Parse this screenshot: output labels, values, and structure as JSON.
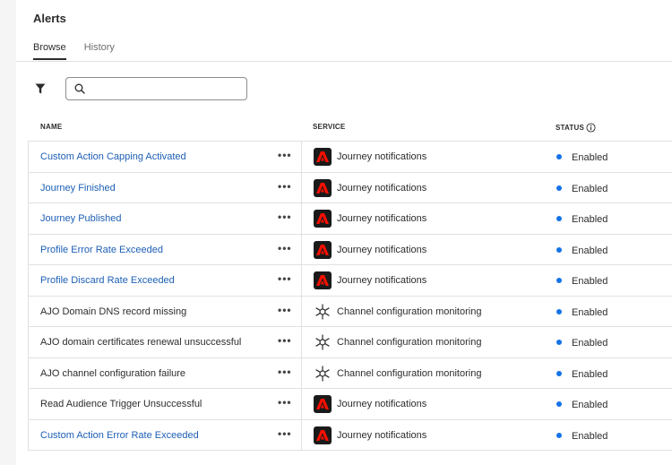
{
  "page": {
    "title": "Alerts",
    "tabs": [
      {
        "label": "Browse",
        "active": true
      },
      {
        "label": "History",
        "active": false
      }
    ]
  },
  "toolbar": {
    "filter_icon": "filter-icon",
    "search": {
      "placeholder": "",
      "value": "",
      "icon": "search-icon"
    }
  },
  "table": {
    "columns": {
      "name": "NAME",
      "service": "SERVICE",
      "status": "STATUS"
    },
    "rows": [
      {
        "name": "Custom Action Capping Activated",
        "link": true,
        "service": "Journey notifications",
        "service_icon": "adobe-icon",
        "status": "Enabled"
      },
      {
        "name": "Journey Finished",
        "link": true,
        "service": "Journey notifications",
        "service_icon": "adobe-icon",
        "status": "Enabled"
      },
      {
        "name": "Journey Published",
        "link": true,
        "service": "Journey notifications",
        "service_icon": "adobe-icon",
        "status": "Enabled"
      },
      {
        "name": "Profile Error Rate Exceeded",
        "link": true,
        "service": "Journey notifications",
        "service_icon": "adobe-icon",
        "status": "Enabled"
      },
      {
        "name": "Profile Discard Rate Exceeded",
        "link": true,
        "service": "Journey notifications",
        "service_icon": "adobe-icon",
        "status": "Enabled"
      },
      {
        "name": "AJO Domain DNS record missing",
        "link": false,
        "service": "Channel configuration monitoring",
        "service_icon": "network-hub-icon",
        "status": "Enabled"
      },
      {
        "name": "AJO domain certificates renewal unsuccessful",
        "link": false,
        "service": "Channel configuration monitoring",
        "service_icon": "network-hub-icon",
        "status": "Enabled"
      },
      {
        "name": "AJO channel configuration failure",
        "link": false,
        "service": "Channel configuration monitoring",
        "service_icon": "network-hub-icon",
        "status": "Enabled"
      },
      {
        "name": "Read Audience Trigger Unsuccessful",
        "link": false,
        "service": "Journey notifications",
        "service_icon": "adobe-icon",
        "status": "Enabled"
      },
      {
        "name": "Custom Action Error Rate Exceeded",
        "link": true,
        "service": "Journey notifications",
        "service_icon": "adobe-icon",
        "status": "Enabled"
      }
    ]
  },
  "colors": {
    "link": "#1d5fb5",
    "status_enabled": "#1473e6",
    "adobe_red": "#fa0f00",
    "adobe_bg": "#1a1a1a"
  }
}
